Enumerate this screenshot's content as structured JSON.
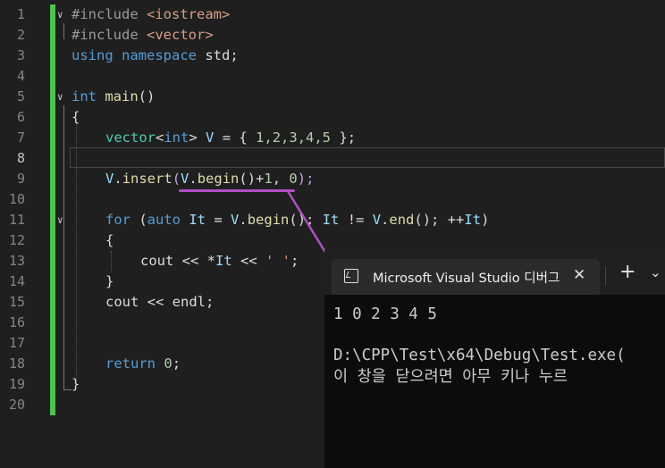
{
  "editor": {
    "line_numbers": [
      "1",
      "2",
      "3",
      "4",
      "5",
      "6",
      "7",
      "8",
      "9",
      "10",
      "11",
      "12",
      "13",
      "14",
      "15",
      "16",
      "17",
      "18",
      "19",
      "20"
    ],
    "lines": {
      "l1_directive": "#include ",
      "l1_header": "<iostream>",
      "l2_directive": "#include ",
      "l2_header": "<vector>",
      "l3_using": "using",
      "l3_namespace": "namespace",
      "l3_std": " std;",
      "l5_int": "int",
      "l5_main": " main",
      "l5_parens": "()",
      "l6_brace": "{",
      "l7_vector": "vector",
      "l7_lt": "<",
      "l7_int": "int",
      "l7_gt": "> ",
      "l7_V": "V",
      "l7_eq": " = { ",
      "l7_nums": "1,2,3,4,5",
      "l7_end": " };",
      "l9_V": "V",
      "l9_dot": ".",
      "l9_insert": "insert",
      "l9_paren": "(",
      "l9_V2": "V",
      "l9_dot2": ".",
      "l9_begin": "begin",
      "l9_plus": "()+",
      "l9_one": "1",
      "l9_comma": ", ",
      "l9_zero": "0",
      "l9_end": ");",
      "l11_for": "for",
      "l11_p": " (",
      "l11_auto": "auto",
      "l11_sp": " ",
      "l11_It": "It",
      "l11_eq": " = ",
      "l11_V": "V",
      "l11_dot": ".",
      "l11_begin": "begin",
      "l11_mid": "(); ",
      "l11_It2": "It",
      "l11_ne": " != ",
      "l11_V2": "V",
      "l11_dot2": ".",
      "l11_end": "end",
      "l11_tail": "(); ++",
      "l11_It3": "It",
      "l11_close": ")",
      "l12_brace": "{",
      "l13_cout": "cout << *",
      "l13_It": "It",
      "l13_ops": " << ",
      "l13_char": "' '",
      "l13_semi": ";",
      "l14_brace": "}",
      "l15_cout": "cout << endl;",
      "l18_return": "return",
      "l18_sp": " ",
      "l18_zero": "0",
      "l18_semi": ";",
      "l19_brace": "}"
    },
    "colors": {
      "keyword": "#569cd6",
      "change_bar": "#4ec24e",
      "annotation": "#b14fc5"
    }
  },
  "console": {
    "tab_title": "Microsoft Visual Studio 디버그",
    "tab_icon": "terminal-icon",
    "close_label": "✕",
    "new_tab_label": "+",
    "dropdown_label": "⌄",
    "output_line1": "1 0 2 3 4 5",
    "output_line2": "D:\\CPP\\Test\\x64\\Debug\\Test.exe(",
    "output_line3": "이 창을 닫으려면 아무 키나 누르"
  }
}
